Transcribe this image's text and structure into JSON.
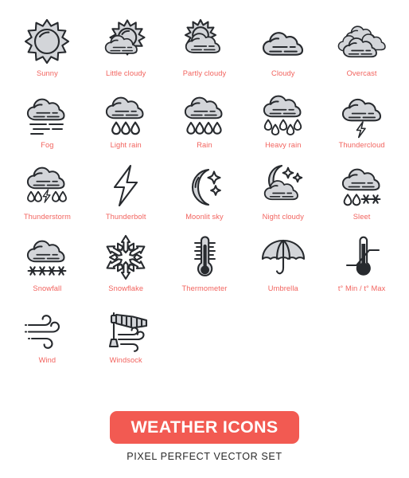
{
  "page": {
    "background_color": "#ffffff",
    "label_color": "#f2635e",
    "icon_line_color": "#272a2e",
    "icon_fill_color": "#d3d5d9"
  },
  "grid": {
    "columns": 5,
    "rows": 5,
    "items": [
      {
        "label": "Sunny",
        "icon": "sun-icon"
      },
      {
        "label": "Little cloudy",
        "icon": "sun-behind-small-cloud-icon"
      },
      {
        "label": "Partly cloudy",
        "icon": "sun-behind-cloud-icon"
      },
      {
        "label": "Cloudy",
        "icon": "cloud-icon"
      },
      {
        "label": "Overcast",
        "icon": "multiple-clouds-icon"
      },
      {
        "label": "Fog",
        "icon": "cloud-with-fog-lines-icon"
      },
      {
        "label": "Light rain",
        "icon": "cloud-with-three-drops-icon"
      },
      {
        "label": "Rain",
        "icon": "cloud-with-four-drops-icon"
      },
      {
        "label": "Heavy rain",
        "icon": "cloud-with-five-drops-icon"
      },
      {
        "label": "Thundercloud",
        "icon": "cloud-with-bolt-icon"
      },
      {
        "label": "Thunderstorm",
        "icon": "cloud-with-drops-and-bolt-icon"
      },
      {
        "label": "Thunderbolt",
        "icon": "lightning-bolt-icon"
      },
      {
        "label": "Moonlit sky",
        "icon": "crescent-moon-with-stars-icon"
      },
      {
        "label": "Night cloudy",
        "icon": "moon-behind-cloud-icon"
      },
      {
        "label": "Sleet",
        "icon": "cloud-with-drops-and-snowflakes-icon"
      },
      {
        "label": "Snowfall",
        "icon": "cloud-with-snowflakes-icon"
      },
      {
        "label": "Snowflake",
        "icon": "snowflake-icon"
      },
      {
        "label": "Thermometer",
        "icon": "thermometer-icon"
      },
      {
        "label": "Umbrella",
        "icon": "umbrella-icon"
      },
      {
        "label": "t° Min / t° Max",
        "icon": "thermometer-min-max-icon"
      },
      {
        "label": "Wind",
        "icon": "wind-icon"
      },
      {
        "label": "Windsock",
        "icon": "windsock-icon"
      }
    ]
  },
  "footer": {
    "banner_title": "WEATHER ICONS",
    "banner_color": "#f25a52",
    "subtitle": "PIXEL PERFECT VECTOR SET"
  }
}
